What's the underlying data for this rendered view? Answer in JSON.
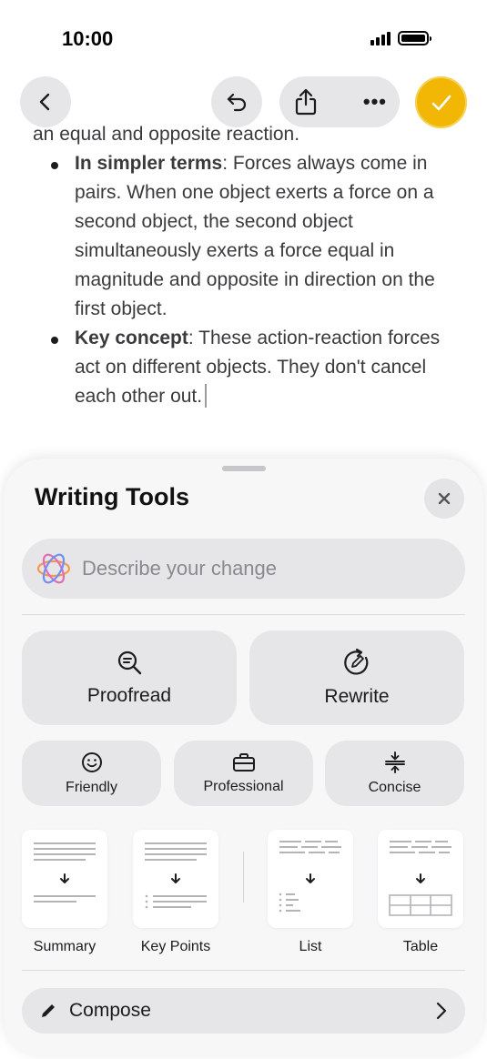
{
  "status": {
    "time": "10:00"
  },
  "document": {
    "lead": "an equal and opposite reaction.",
    "bullets": [
      {
        "term": "In simpler terms",
        "text": ": Forces always come in pairs. When one object exerts a force on a second object, the second object simultaneously exerts a force equal in magnitude and opposite in direction on the first object."
      },
      {
        "term": "Key concept",
        "text": ": These action-reaction forces act on different objects. They don't cancel each other out."
      }
    ]
  },
  "toolbar": {
    "back_icon": "chevron-left-icon",
    "undo_icon": "undo-icon",
    "share_icon": "share-icon",
    "more_label": "•••",
    "done_icon": "checkmark-icon",
    "done_color": "#f2b705"
  },
  "writing_tools": {
    "title": "Writing Tools",
    "close_label": "✕",
    "describe_placeholder": "Describe your change",
    "proofread_label": "Proofread",
    "rewrite_label": "Rewrite",
    "tones": [
      {
        "label": "Friendly",
        "icon": "smiley-icon"
      },
      {
        "label": "Professional",
        "icon": "briefcase-icon"
      },
      {
        "label": "Concise",
        "icon": "concise-icon"
      }
    ],
    "formats": [
      {
        "label": "Summary",
        "icon": "summary-icon"
      },
      {
        "label": "Key Points",
        "icon": "key-points-icon"
      },
      {
        "label": "List",
        "icon": "list-icon"
      },
      {
        "label": "Table",
        "icon": "table-icon"
      }
    ],
    "compose_label": "Compose"
  }
}
